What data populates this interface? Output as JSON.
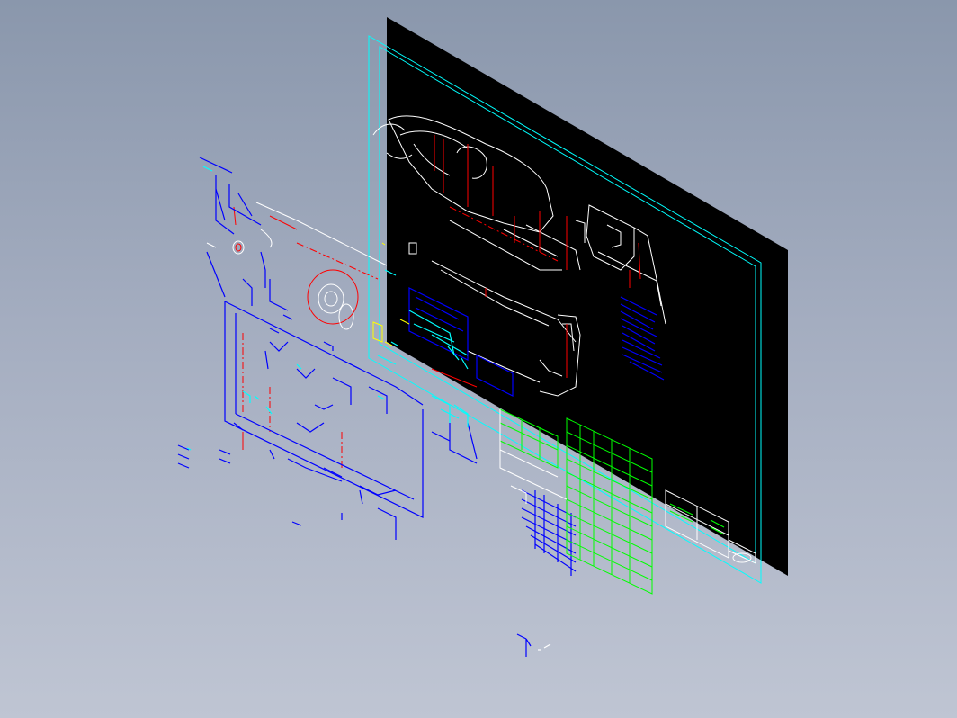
{
  "viewport": {
    "background_top": "#8a97ac",
    "background_bottom": "#bfc5d3"
  },
  "drawing_sheet": {
    "fill": "#000000",
    "border_color": "#00ffff"
  },
  "line_colors": {
    "geometry": "#ffffff",
    "centerline": "#ff0000",
    "dimension": "#0000ff",
    "annotation": "#00ffff",
    "table": "#00ff00",
    "highlight": "#ffff00"
  },
  "icons": {
    "view_axis": "axis-triad-icon"
  }
}
